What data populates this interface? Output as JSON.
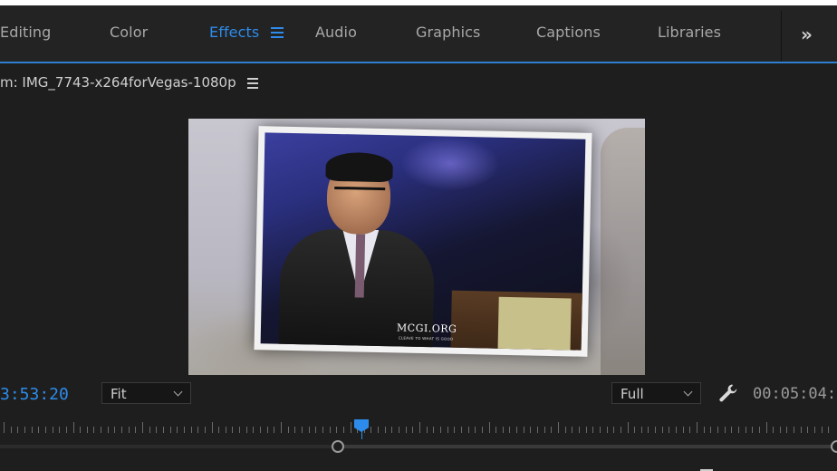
{
  "workspace_tabs": [
    {
      "label": "Editing",
      "active": false
    },
    {
      "label": "Color",
      "active": false
    },
    {
      "label": "Effects",
      "active": true
    },
    {
      "label": "Audio",
      "active": false
    },
    {
      "label": "Graphics",
      "active": false
    },
    {
      "label": "Captions",
      "active": false
    },
    {
      "label": "Libraries",
      "active": false
    }
  ],
  "workspace_menu_icon": "hamburger-menu-icon",
  "overflow_icon": "double-chevron-right-icon",
  "overflow_glyph": "»",
  "program_monitor": {
    "title": "m: IMG_7743-x264forVegas-1080p",
    "menu_icon": "hamburger-menu-icon"
  },
  "video_frame": {
    "logo_text": "MCGI.ORG",
    "logo_subtext": "CLEAVE TO WHAT IS GOOD"
  },
  "controls": {
    "playhead_timecode": "3:53:20",
    "zoom_dropdown": "Fit",
    "resolution_dropdown": "Full",
    "settings_icon": "wrench-icon",
    "duration_timecode": "00:05:04:"
  },
  "timeline": {
    "playhead_position_fraction": 0.432
  },
  "colors": {
    "accent": "#2d8ceb",
    "background": "#1e1e1e",
    "text": "#bdbdbd"
  }
}
